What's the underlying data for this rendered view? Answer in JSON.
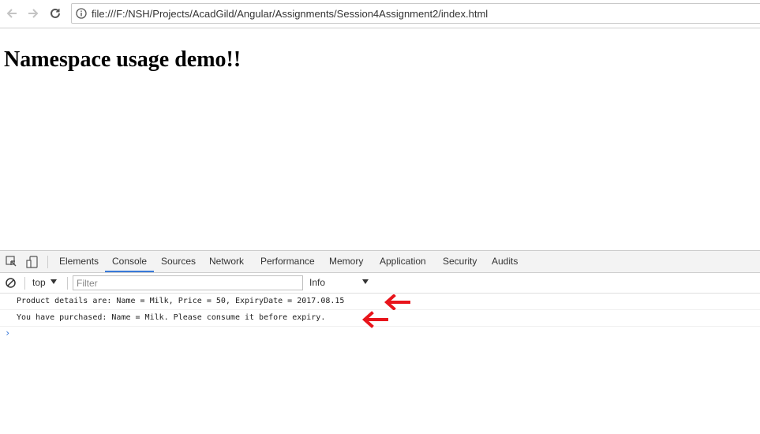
{
  "browser": {
    "back_icon": "arrow-left-icon",
    "forward_icon": "arrow-right-icon",
    "reload_icon": "reload-icon",
    "info_icon": "info-icon",
    "url": "file:///F:/NSH/Projects/AcadGild/Angular/Assignments/Session4Assignment2/index.html"
  },
  "page": {
    "title": "Namespace usage demo!!"
  },
  "devtools": {
    "tabs": [
      {
        "label": "Elements"
      },
      {
        "label": "Console"
      },
      {
        "label": "Sources"
      },
      {
        "label": "Network"
      },
      {
        "label": "Performance"
      },
      {
        "label": "Memory"
      },
      {
        "label": "Application"
      },
      {
        "label": "Security"
      },
      {
        "label": "Audits"
      }
    ],
    "active_tab": "Console",
    "context": "top",
    "filter_placeholder": "Filter",
    "level": "Info",
    "messages": [
      {
        "text": "Product details are: Name = Milk, Price = 50, ExpiryDate = 2017.08.15"
      },
      {
        "text": "You have purchased: Name = Milk. Please consume it before expiry."
      }
    ],
    "prompt_symbol": "›",
    "accent_color": "#3879d9",
    "annotation_color": "#e8141b"
  }
}
